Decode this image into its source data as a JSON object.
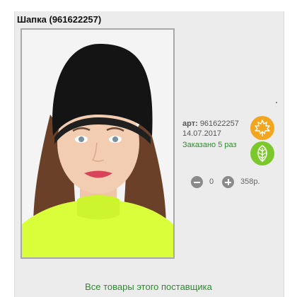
{
  "product": {
    "title": "Шапка (961622257)",
    "article_label": "арт:",
    "article_value": "961622257",
    "date": "14.07.2017",
    "ordered_text": "Заказано 5 раз",
    "quantity": "0",
    "price": "358р.",
    "supplier_link": "Все товары этого поставщика"
  },
  "icons": {
    "season_autumn": "maple-leaf-icon",
    "season_spring": "leaf-icon",
    "minus": "minus-icon",
    "plus": "plus-icon"
  },
  "colors": {
    "autumn_badge": "#f2a51e",
    "spring_badge": "#7cc82c",
    "link_green": "#2e8b2e"
  }
}
